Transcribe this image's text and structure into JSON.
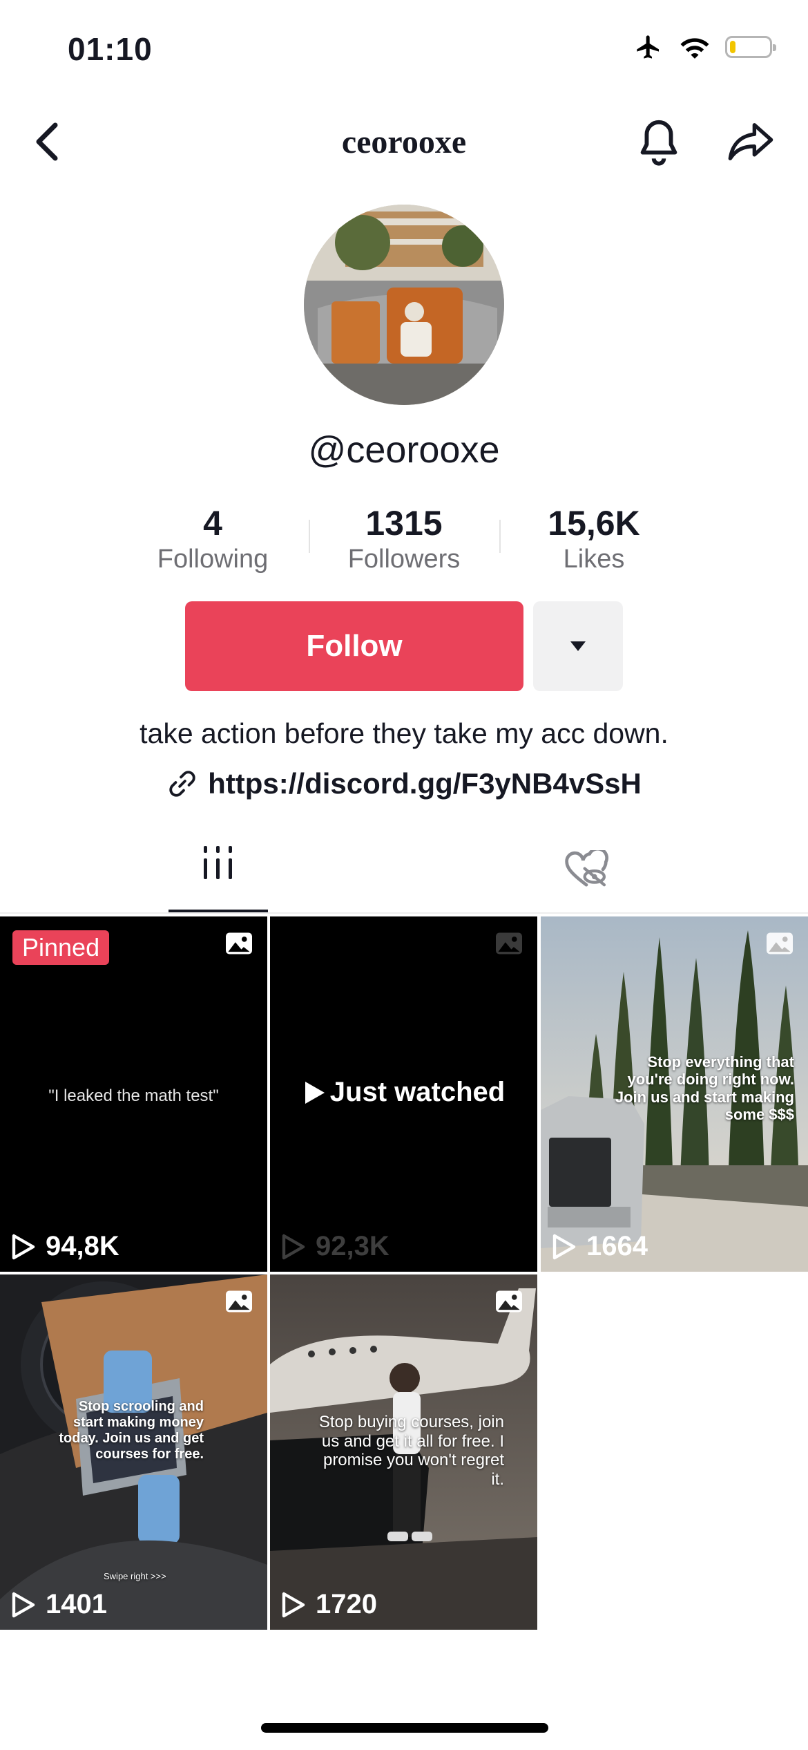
{
  "status_bar": {
    "time": "01:10"
  },
  "header": {
    "title": "ceorooxe"
  },
  "profile": {
    "handle": "@ceorooxe",
    "bio": "take action before they take my acc down.",
    "link": "https://discord.gg/F3yNB4vSsH"
  },
  "stats": [
    {
      "value": "4",
      "label": "Following"
    },
    {
      "value": "1315",
      "label": "Followers"
    },
    {
      "value": "15,6K",
      "label": "Likes"
    }
  ],
  "buttons": {
    "follow": "Follow"
  },
  "colors": {
    "accent": "#ea4359",
    "text": "#161823",
    "muted": "#6e6e73"
  },
  "icons": [
    "back-icon",
    "bell-icon",
    "share-icon",
    "link-icon",
    "videos-grid-icon",
    "liked-hidden-icon",
    "photo-icon",
    "play-icon"
  ],
  "videos": [
    {
      "views": "94,8K",
      "badge": "Pinned",
      "caption": "\"I leaked the math test\""
    },
    {
      "views": "92,3K",
      "status": "Just watched"
    },
    {
      "views": "1664",
      "caption": "Stop everything that you're doing right now. Join us and start making some $$$"
    },
    {
      "views": "1401",
      "caption": "Stop scrooling and start making money today. Join us and get courses for free.",
      "subcaption": "Swipe right >>>"
    },
    {
      "views": "1720",
      "caption": "Stop buying courses, join us and get it all for free. I promise you won't regret it."
    }
  ]
}
